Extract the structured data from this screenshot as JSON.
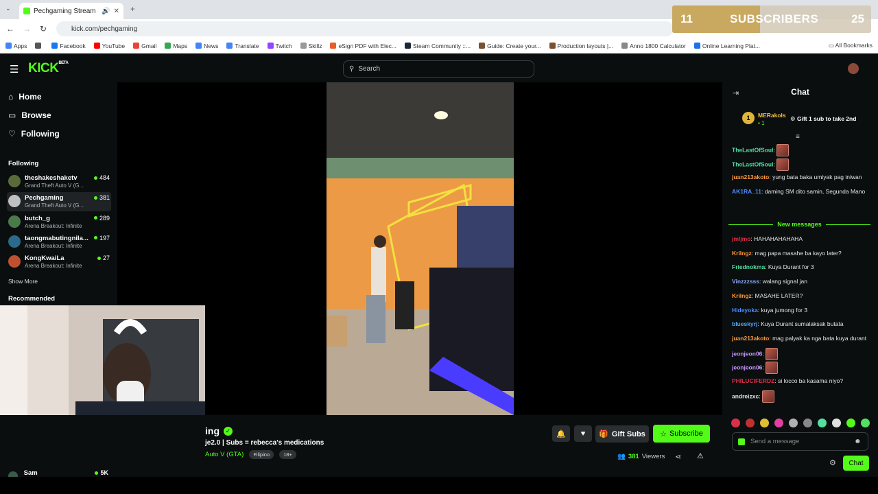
{
  "browser": {
    "tab_title": "Pechgaming Stream - Watch",
    "url": "kick.com/pechgaming",
    "bookmarks": [
      {
        "label": "Apps",
        "color": "#4285f4"
      },
      {
        "label": "",
        "color": "#555555"
      },
      {
        "label": "Facebook",
        "color": "#1877f2"
      },
      {
        "label": "YouTube",
        "color": "#ff0000"
      },
      {
        "label": "Gmail",
        "color": "#ea4335"
      },
      {
        "label": "Maps",
        "color": "#34a853"
      },
      {
        "label": "News",
        "color": "#4285f4"
      },
      {
        "label": "Translate",
        "color": "#4285f4"
      },
      {
        "label": "Twitch",
        "color": "#9146ff"
      },
      {
        "label": "Skillz",
        "color": "#999999"
      },
      {
        "label": "eSign PDF with Elec...",
        "color": "#e85d2a"
      },
      {
        "label": "Steam Community ::...",
        "color": "#1b2838"
      },
      {
        "label": "Guide: Create your...",
        "color": "#7a5230"
      },
      {
        "label": "Production layouts |...",
        "color": "#7a5230"
      },
      {
        "label": "Anno 1800 Calculator",
        "color": "#888888"
      },
      {
        "label": "Online Learning Plat...",
        "color": "#1a73e8"
      }
    ],
    "all_bookmarks": "All Bookmarks"
  },
  "overlay": {
    "left_count": "11",
    "label": "SUBSCRIBERS",
    "goal": "25",
    "progress": 0.44
  },
  "header": {
    "logo": "KICK",
    "logo_sup": "BETA",
    "search_placeholder": "Search"
  },
  "sidebar": {
    "nav": [
      {
        "label": "Home",
        "icon": "home-icon"
      },
      {
        "label": "Browse",
        "icon": "browse-icon"
      },
      {
        "label": "Following",
        "icon": "heart-icon"
      }
    ],
    "following_title": "Following",
    "channels": [
      {
        "name": "theshakeshaketv",
        "game": "Grand Theft Auto V (G...",
        "viewers": "484",
        "color": "#5a6b3a"
      },
      {
        "name": "Pechgaming",
        "game": "Grand Theft Auto V (G...",
        "viewers": "381",
        "color": "#c0c0c0"
      },
      {
        "name": "butch_g",
        "game": "Arena Breakout: Infinite",
        "viewers": "289",
        "color": "#4a7a4a"
      },
      {
        "name": "taongmabutingnila...",
        "game": "Arena Breakout: Infinite",
        "viewers": "197",
        "color": "#2a6a8a"
      },
      {
        "name": "KongKwaiLa",
        "game": "Arena Breakout: Infinite",
        "viewers": "27",
        "color": "#c05030"
      }
    ],
    "show_more": "Show More",
    "recommended_title": "Recommended",
    "recommended": [
      {
        "name": "Sam",
        "viewers": "5K"
      }
    ]
  },
  "stream": {
    "name_visible": "ing",
    "title": "je2.0 | Subs = rebecca's medications",
    "category": "Auto V (GTA)",
    "tags": [
      "Filipino",
      "18+"
    ],
    "gift_subs": "Gift Subs",
    "subscribe": "Subscribe",
    "viewers": "381",
    "viewers_label": "Viewers"
  },
  "chat": {
    "title": "Chat",
    "pinned": {
      "rank": "1",
      "user": "MERakols",
      "count": "1",
      "text": "Gift 1 sub to take 2nd"
    },
    "messages_before": [
      {
        "user": "TheLastOfSoul",
        "color": "#53e0a0",
        "text": "",
        "emote": true
      },
      {
        "user": "TheLastOfSoul",
        "color": "#53e0a0",
        "text": "",
        "emote": true
      },
      {
        "user": "juan213akoto",
        "color": "#ff9a3c",
        "text": "yung bata baka umiyak pag iniwan",
        "emote": false
      },
      {
        "user": "AK1RA_11",
        "color": "#4f8bff",
        "text": "daming SM dito samin, Segunda Mano",
        "emote": false
      }
    ],
    "new_messages_label": "New messages",
    "messages_after": [
      {
        "user": "jmljmo",
        "color": "#d9304a",
        "text": "HAHAHAHAHAHA",
        "emote": false
      },
      {
        "user": "Krilngz",
        "color": "#ff9a3c",
        "text": "mag papa masahe ba kayo later?",
        "emote": false
      },
      {
        "user": "Friednokma",
        "color": "#53e0a0",
        "text": "Kuya Durant for 3",
        "emote": false
      },
      {
        "user": "Vinzzzsss",
        "color": "#8aa8ff",
        "text": "walang signal jan",
        "emote": false
      },
      {
        "user": "Krilngz",
        "color": "#ff9a3c",
        "text": "MASAHE LATER?",
        "emote": false
      },
      {
        "user": "Hideyoka",
        "color": "#4f8bff",
        "text": "kuya jumong for 3",
        "emote": false
      },
      {
        "user": "blueskyrj",
        "color": "#4fa8ff",
        "text": "Kuya Durant sumalaksak butata",
        "emote": false
      },
      {
        "user": "juan213akoto",
        "color": "#ff9a3c",
        "text": "mag palyak ka nga bata kuya durant",
        "emote": false
      },
      {
        "user": "jeonjeon06",
        "color": "#c99aff",
        "text": "",
        "emote": true
      },
      {
        "user": "jeonjeon06",
        "color": "#c99aff",
        "text": "",
        "emote": true
      },
      {
        "user": "PHILUCIFERDZ",
        "color": "#d9304a",
        "text": "si locco ba kasama niyo?",
        "emote": false
      },
      {
        "user": "andreizxc",
        "color": "#e0e0e0",
        "text": "",
        "emote": true
      }
    ],
    "emotes": [
      "#d9304a",
      "#c03030",
      "#e0c030",
      "#e040a0",
      "#b0b0b0",
      "#888888",
      "#53e0a0",
      "#e0e0e0",
      "#53fc18",
      "#53e060"
    ],
    "input_placeholder": "Send a message",
    "chat_button": "Chat"
  }
}
